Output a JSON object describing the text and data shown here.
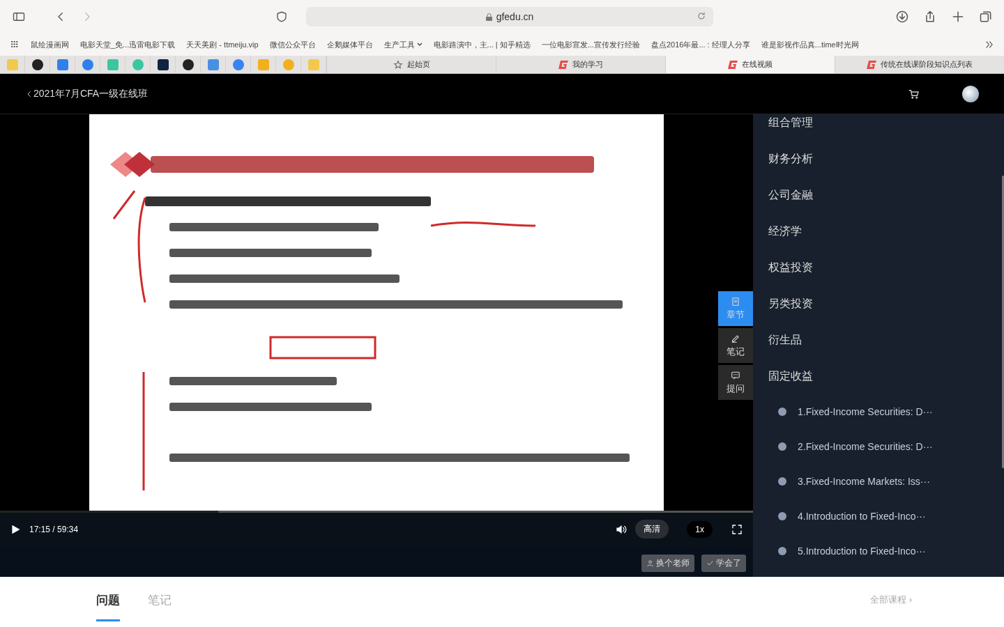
{
  "browser": {
    "address": "gfedu.cn",
    "bookmarks": [
      {
        "label": "鼠绘漫画网",
        "kind": "link"
      },
      {
        "label": "电影天堂_免...迅雷电影下载",
        "kind": "link"
      },
      {
        "label": "天天美剧 - ttmeiju.vip",
        "kind": "link"
      },
      {
        "label": "微信公众平台",
        "kind": "link"
      },
      {
        "label": "企鹅媒体平台",
        "kind": "link"
      },
      {
        "label": "生产工具",
        "kind": "folder"
      },
      {
        "label": "电影路演中，主... | 知乎精选",
        "kind": "link"
      },
      {
        "label": "一位电影宣发...宣传发行经验",
        "kind": "link"
      },
      {
        "label": "盘点2016年最... : 经理人分享",
        "kind": "link"
      },
      {
        "label": "谁是影视作品真...time时光网",
        "kind": "link"
      }
    ],
    "pinned_tabs": [
      {
        "color": "#f2c94c"
      },
      {
        "color": "#222222"
      },
      {
        "color": "#2f80ed"
      },
      {
        "color": "#2f80ed"
      },
      {
        "color": "#3cc6a0"
      },
      {
        "color": "#3cc6a0"
      },
      {
        "color": "#10243f"
      },
      {
        "color": "#222222"
      },
      {
        "color": "#4a90e2"
      },
      {
        "color": "#3b82f6"
      },
      {
        "color": "#f2b01e"
      },
      {
        "color": "#f2b01e"
      },
      {
        "color": "#f2c94c"
      }
    ],
    "tabs": [
      {
        "label": "起始页",
        "kind": "start",
        "selected": false
      },
      {
        "label": "我的学习",
        "kind": "site",
        "selected": false
      },
      {
        "label": "在线视频",
        "kind": "site",
        "selected": true
      },
      {
        "label": "传统在线课阶段知识点列表",
        "kind": "site",
        "selected": false
      }
    ]
  },
  "header": {
    "title": "2021年7月CFA一级在线班"
  },
  "player": {
    "time": "17:15 / 59:34",
    "level": 0.29,
    "quality": "高清",
    "speed": "1x"
  },
  "video_actions": [
    "换个老师",
    "学会了"
  ],
  "side_tabs": [
    {
      "label": "章节",
      "kind": "chapters",
      "selected": true
    },
    {
      "label": "笔记",
      "kind": "notes",
      "selected": false
    },
    {
      "label": "提问",
      "kind": "questions",
      "selected": false
    }
  ],
  "chapters": [
    {
      "label": "组合管理"
    },
    {
      "label": "财务分析"
    },
    {
      "label": "公司金融"
    },
    {
      "label": "经济学"
    },
    {
      "label": "权益投资"
    },
    {
      "label": "另类投资"
    },
    {
      "label": "衍生品"
    },
    {
      "label": "固定收益",
      "children": [
        {
          "label": "1.Fixed-Income Securities:  D···"
        },
        {
          "label": "2.Fixed-Income Securities:  D···"
        },
        {
          "label": "3.Fixed-Income Markets:  Iss···"
        },
        {
          "label": "4.Introduction to Fixed-Inco···"
        },
        {
          "label": "5.Introduction to Fixed-Inco···"
        }
      ]
    }
  ],
  "bottom_tabs": [
    {
      "label": "问题",
      "selected": true
    },
    {
      "label": "笔记",
      "selected": false
    }
  ],
  "all_courses": "全部课程 ›"
}
